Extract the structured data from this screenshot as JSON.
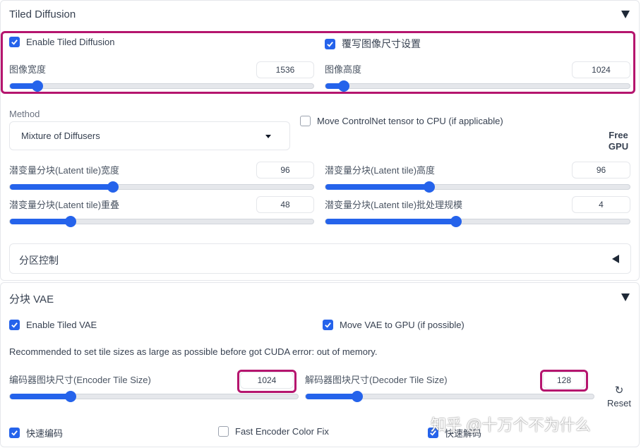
{
  "tiled_diffusion": {
    "title": "Tiled Diffusion",
    "enable_label": "Enable Tiled Diffusion",
    "enable_checked": true,
    "overwrite_label": "覆写图像尺寸设置",
    "overwrite_checked": true,
    "image_width": {
      "label": "图像宽度",
      "value": "1536",
      "fraction": 0.09
    },
    "image_height": {
      "label": "图像高度",
      "value": "1024",
      "fraction": 0.06
    },
    "method": {
      "label": "Method",
      "value": "Mixture of Diffusers"
    },
    "move_controlnet": {
      "label": "Move ControlNet tensor to CPU (if applicable)",
      "checked": false
    },
    "free_gpu_line1": "Free",
    "free_gpu_line2": "GPU",
    "latent_tile_width": {
      "label": "潜变量分块(Latent tile)宽度",
      "value": "96",
      "fraction": 0.34
    },
    "latent_tile_height": {
      "label": "潜变量分块(Latent tile)高度",
      "value": "96",
      "fraction": 0.34
    },
    "latent_tile_overlap": {
      "label": "潜变量分块(Latent tile)重叠",
      "value": "48",
      "fraction": 0.2
    },
    "latent_tile_batch": {
      "label": "潜变量分块(Latent tile)批处理规模",
      "value": "4",
      "fraction": 0.43
    },
    "region_control": {
      "title": "分区控制"
    }
  },
  "tiled_vae": {
    "title": "分块 VAE",
    "enable_label": "Enable Tiled VAE",
    "enable_checked": true,
    "move_gpu_label": "Move VAE to GPU (if possible)",
    "move_gpu_checked": true,
    "note": "Recommended to set tile sizes as large as possible before got CUDA error: out of memory.",
    "encoder_tile": {
      "label": "编码器图块尺寸(Encoder Tile Size)",
      "value": "1024",
      "fraction": 0.21
    },
    "decoder_tile": {
      "label": "解码器图块尺寸(Decoder Tile Size)",
      "value": "128",
      "fraction": 0.18
    },
    "reset_label": "Reset",
    "fast_encoder": {
      "label": "快速编码",
      "checked": true
    },
    "fast_encoder_color_fix": {
      "label": "Fast Encoder Color Fix",
      "checked": false
    },
    "fast_decoder": {
      "label": "快速解码",
      "checked": true
    }
  },
  "watermark": "知乎 @十万个不为什么",
  "colors": {
    "accent": "#2563eb",
    "highlight": "#b5156e"
  }
}
